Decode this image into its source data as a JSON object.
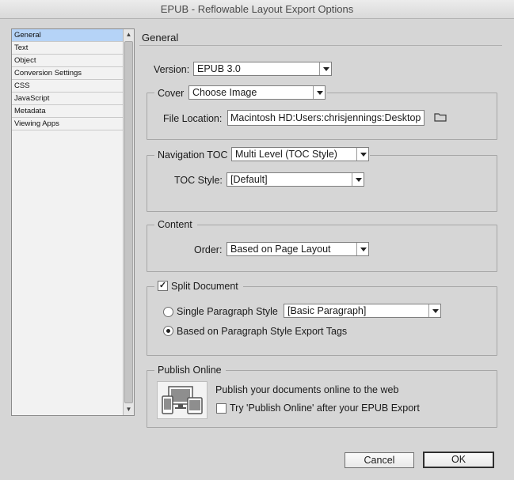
{
  "window": {
    "title": "EPUB - Reflowable Layout Export Options"
  },
  "sidebar": {
    "items": [
      {
        "label": "General",
        "selected": true
      },
      {
        "label": "Text"
      },
      {
        "label": "Object"
      },
      {
        "label": "Conversion Settings"
      },
      {
        "label": "CSS"
      },
      {
        "label": "JavaScript"
      },
      {
        "label": "Metadata"
      },
      {
        "label": "Viewing Apps"
      }
    ]
  },
  "general": {
    "header": "General",
    "version": {
      "label": "Version:",
      "value": "EPUB 3.0"
    },
    "cover": {
      "label": "Cover",
      "value": "Choose Image",
      "file_location_label": "File Location:",
      "file_location_value": "Macintosh HD:Users:chrisjennings:Desktop"
    },
    "navigation": {
      "label": "Navigation TOC",
      "value": "Multi Level (TOC Style)",
      "toc_style_label": "TOC Style:",
      "toc_style_value": "[Default]"
    },
    "content": {
      "label": "Content",
      "order_label": "Order:",
      "order_value": "Based on Page Layout"
    },
    "split": {
      "label": "Split Document",
      "checked": true,
      "check_mark": "✓",
      "single_label": "Single Paragraph Style",
      "single_value": "[Basic Paragraph]",
      "tags_label": "Based on Paragraph Style Export Tags",
      "selected": "tags"
    },
    "publish": {
      "label": "Publish Online",
      "description": "Publish your documents online to the web",
      "checkbox_label": "Try 'Publish Online' after your EPUB Export",
      "checked": false
    }
  },
  "buttons": {
    "cancel": "Cancel",
    "ok": "OK"
  }
}
